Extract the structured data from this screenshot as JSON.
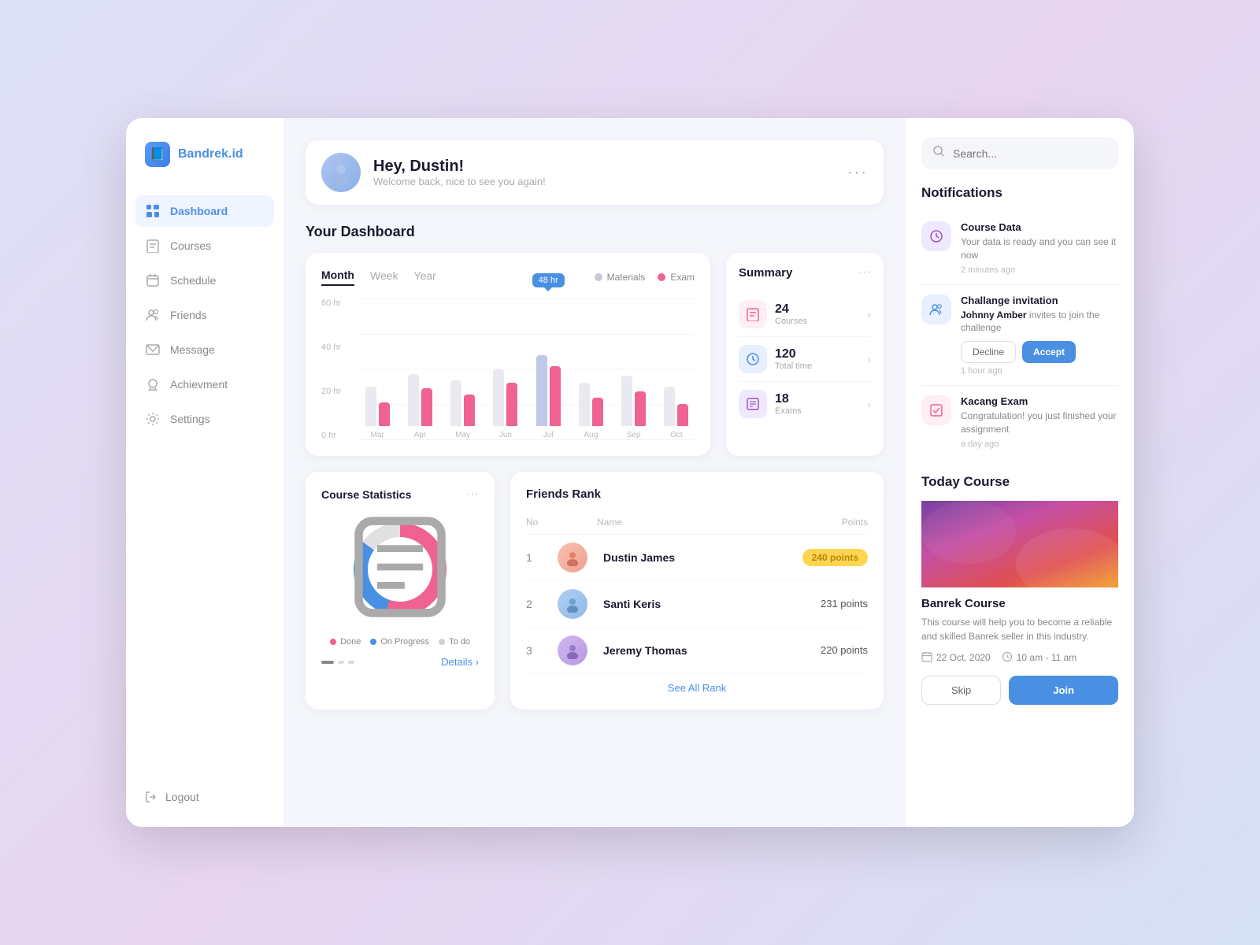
{
  "app": {
    "name": "Bandrek.id",
    "logo_icon": "📘"
  },
  "sidebar": {
    "items": [
      {
        "id": "dashboard",
        "label": "Dashboard",
        "icon": "⊞",
        "active": true
      },
      {
        "id": "courses",
        "label": "Courses",
        "icon": "📄"
      },
      {
        "id": "schedule",
        "label": "Schedule",
        "icon": "🗓"
      },
      {
        "id": "friends",
        "label": "Friends",
        "icon": "👥"
      },
      {
        "id": "message",
        "label": "Message",
        "icon": "✉"
      },
      {
        "id": "achievement",
        "label": "Achievment",
        "icon": "⚙"
      },
      {
        "id": "settings",
        "label": "Settings",
        "icon": "⚙"
      }
    ],
    "logout_label": "Logout"
  },
  "header": {
    "greeting": "Hey, Dustin!",
    "subtitle": "Welcome back, nice to see you again!",
    "avatar_icon": "👤"
  },
  "dashboard": {
    "title": "Your Dashboard"
  },
  "chart": {
    "tabs": [
      "Month",
      "Week",
      "Year"
    ],
    "active_tab": "Month",
    "legend": {
      "materials_label": "Materials",
      "exam_label": "Exam"
    },
    "y_labels": [
      "60 hr",
      "40 hr",
      "20 hr",
      "0 hr"
    ],
    "bars": [
      {
        "month": "Mar",
        "gray": 45,
        "pink": 30
      },
      {
        "month": "Apr",
        "gray": 60,
        "pink": 45
      },
      {
        "month": "May",
        "gray": 55,
        "pink": 38
      },
      {
        "month": "Jun",
        "gray": 65,
        "pink": 50
      },
      {
        "month": "Jul",
        "gray": 80,
        "pink": 70,
        "tooltip": "48 hr",
        "highlight": true
      },
      {
        "month": "Aug",
        "gray": 50,
        "pink": 35
      },
      {
        "month": "Sep",
        "gray": 60,
        "pink": 42
      },
      {
        "month": "Oct",
        "gray": 48,
        "pink": 28
      }
    ]
  },
  "summary": {
    "title": "Summary",
    "items": [
      {
        "label": "Courses",
        "value": "24",
        "icon": "📋",
        "bg": "pink-bg"
      },
      {
        "label": "Total time",
        "value": "120",
        "icon": "🕐",
        "bg": "blue-bg"
      },
      {
        "label": "Exams",
        "value": "18",
        "icon": "📊",
        "bg": "purple-bg"
      }
    ]
  },
  "course_stats": {
    "title": "Course Statistics",
    "legend": [
      {
        "label": "Done",
        "color": "#f06292"
      },
      {
        "label": "On Progress",
        "color": "#4a90e2"
      },
      {
        "label": "To do",
        "color": "#e0e0e0"
      }
    ],
    "donut": {
      "done_pct": 55,
      "progress_pct": 30,
      "todo_pct": 15
    },
    "details_label": "Details",
    "center_icon": "📋"
  },
  "friends_rank": {
    "title": "Friends Rank",
    "columns": [
      "No",
      "Name",
      "Points"
    ],
    "rows": [
      {
        "no": 1,
        "name": "Dustin James",
        "points": "240 points",
        "highlight": true,
        "avatar_color": "#f0a0a0"
      },
      {
        "no": 2,
        "name": "Santi Keris",
        "points": "231 points",
        "highlight": false,
        "avatar_color": "#a0c0f0"
      },
      {
        "no": 3,
        "name": "Jeremy Thomas",
        "points": "220 points",
        "highlight": false,
        "avatar_color": "#c0a0f0"
      }
    ],
    "see_all_label": "See All Rank"
  },
  "notifications": {
    "title": "Notifications",
    "items": [
      {
        "id": "course_data",
        "title": "Course Data",
        "desc": "Your data is ready and you can see it now",
        "time": "2 minutes ago",
        "icon": "🕐",
        "bg": "purple-bg"
      },
      {
        "id": "challenge",
        "title": "Challange invitation",
        "desc_prefix": "",
        "highlight_name": "Johnny Amber",
        "desc_suffix": " invites to join the challenge",
        "time": "1 hour ago",
        "icon": "👥",
        "bg": "blue-bg",
        "has_actions": true,
        "decline_label": "Decline",
        "accept_label": "Accept"
      },
      {
        "id": "kacang_exam",
        "title": "Kacang Exam",
        "desc": "Congratulation! you just finished your assignment",
        "time": "a day ago",
        "icon": "📋",
        "bg": "pink-bg"
      }
    ]
  },
  "today_course": {
    "title": "Today Course",
    "course_name": "Banrek Course",
    "course_desc": "This course will help you to become a reliable and skilled Banrek seller in this industry.",
    "date": "22 Oct, 2020",
    "time": "10 am - 11 am",
    "skip_label": "Skip",
    "join_label": "Join"
  },
  "search": {
    "placeholder": "Search..."
  }
}
